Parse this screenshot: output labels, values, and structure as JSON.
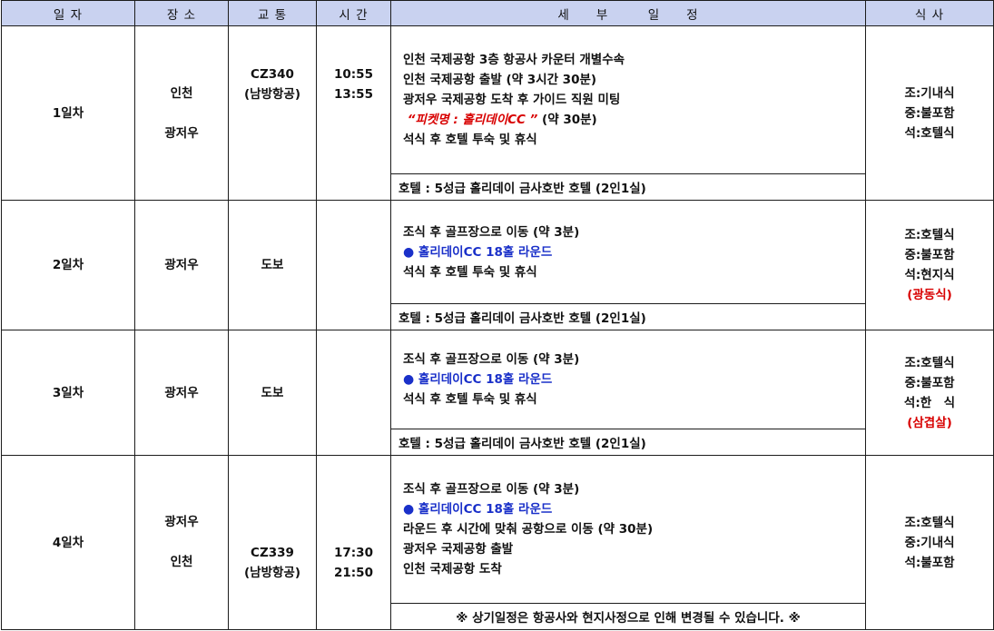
{
  "headers": [
    "일 자",
    "장 소",
    "교 통",
    "시 간",
    "세　　부　　　일　　정",
    "식 사"
  ],
  "days": [
    {
      "day": "1일차",
      "places": [
        "인천",
        "광저우"
      ],
      "transport": [
        "CZ340",
        "(남방항공)"
      ],
      "times": [
        "10:55",
        "13:55"
      ],
      "plan": [
        "인천 국제공항 3층 항공사 카운터 개별수속",
        "인천 국제공항 출발 (약 3시간 30분)",
        "광저우 국제공항 도착 후 가이드 직원 미팅"
      ],
      "ticket_text": "“피켓명 : 홀리데이CC ”",
      "ticket_suffix": " (약 30분)",
      "plan_after": "석식 후 호텔 투숙 및 휴식",
      "hotel": "호텔 :  5성급 홀리데이 금사호반 호텔 (2인1실)",
      "meals": [
        "조:기내식",
        "중:불포함",
        "석:호텔식"
      ]
    },
    {
      "day": "2일차",
      "places": [
        "광저우"
      ],
      "transport": [
        "도보"
      ],
      "plan_first": "조식 후 골프장으로 이동 (약 3분)",
      "round_bullet": "●",
      "round_text": "홀리데이CC 18홀 라운드",
      "plan_after": "석식 후 호텔 투숙 및 휴식",
      "hotel": "호텔 :  5성급 홀리데이 금사호반 호텔 (2인1실)",
      "meals": [
        "조:호텔식",
        "중:불포함",
        "석:현지식"
      ],
      "meal_note": "(광동식)"
    },
    {
      "day": "3일차",
      "places": [
        "광저우"
      ],
      "transport": [
        "도보"
      ],
      "plan_first": "조식 후 골프장으로 이동 (약 3분)",
      "round_bullet": "●",
      "round_text": "홀리데이CC 18홀 라운드",
      "plan_after": "석식 후 호텔 투숙 및 휴식",
      "hotel": "호텔 :  5성급 홀리데이 금사호반 호텔 (2인1실)",
      "meals": [
        "조:호텔식",
        "중:불포함",
        "석:한　식"
      ],
      "meal_note": "(삼겹살)"
    },
    {
      "day": "4일차",
      "places": [
        "광저우",
        "인천"
      ],
      "transport": [
        "CZ339",
        "(남방항공)"
      ],
      "times": [
        "17:30",
        "21:50"
      ],
      "plan_first": "조식 후 골프장으로 이동 (약 3분)",
      "round_bullet": "●",
      "round_text": "홀리데이CC 18홀 라운드",
      "plan_rest": [
        "라운드 후 시간에 맞춰 공항으로 이동 (약 30분)",
        "광저우 국제공항 출발",
        "인천 국제공항 도착"
      ],
      "notice": "※ 상기일정은 항공사와 현지사정으로 인해 변경될 수 있습니다. ※",
      "meals": [
        "조:호텔식",
        "중:기내식",
        "석:불포함"
      ]
    }
  ],
  "colors": {
    "header_bg": "#c9d2f0",
    "red": "#d80000",
    "blue": "#1a30c9",
    "border": "#1c1c1c"
  }
}
